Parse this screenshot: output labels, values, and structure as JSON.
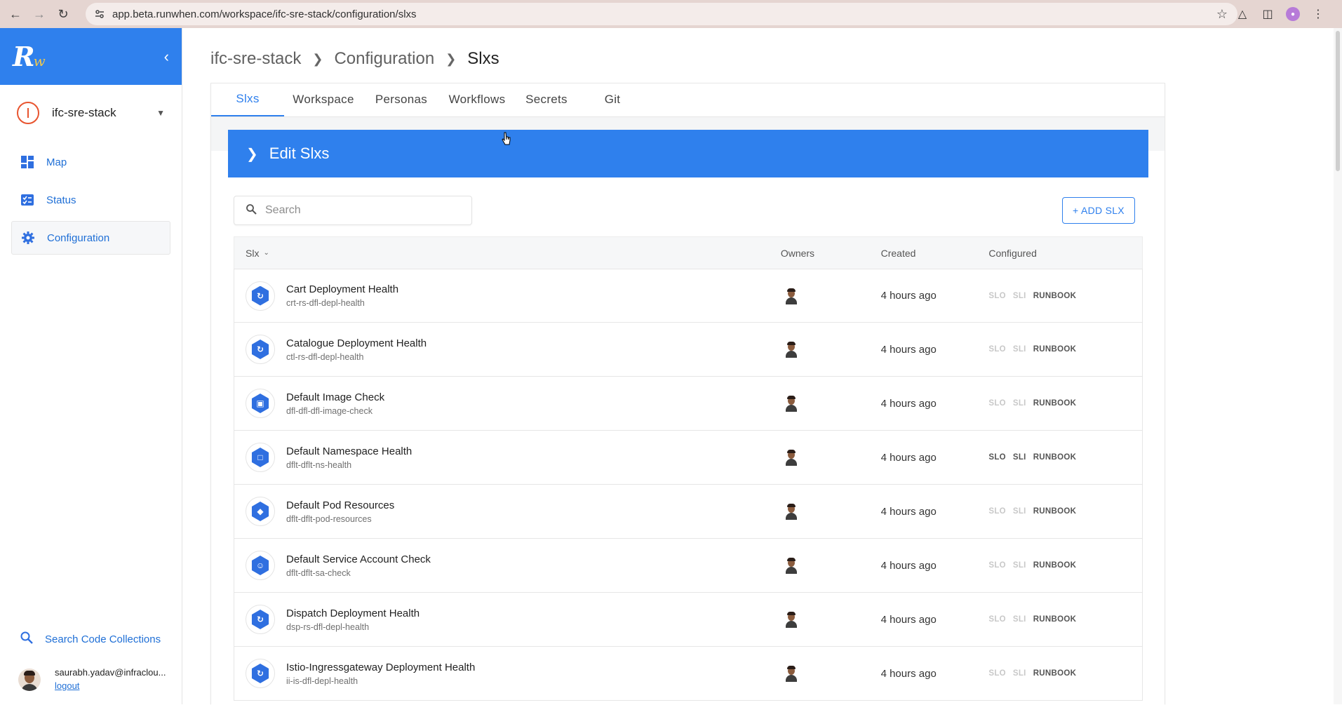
{
  "browser": {
    "url": "app.beta.runwhen.com/workspace/ifc-sre-stack/configuration/slxs"
  },
  "sidebar": {
    "logo_main": "R",
    "logo_small": "w",
    "workspace": "ifc-sre-stack",
    "items": [
      {
        "label": "Map",
        "icon": "dashboard-icon"
      },
      {
        "label": "Status",
        "icon": "checklist-icon"
      },
      {
        "label": "Configuration",
        "icon": "gear-icon"
      }
    ],
    "search_code_collections": "Search Code Collections",
    "user_email": "saurabh.yadav@infraclou...",
    "logout": "logout"
  },
  "breadcrumb": [
    "ifc-sre-stack",
    "Configuration",
    "Slxs"
  ],
  "tabs": [
    "Slxs",
    "Workspace",
    "Personas",
    "Workflows",
    "Secrets",
    "Git"
  ],
  "banner": {
    "title": "Edit Slxs"
  },
  "search": {
    "placeholder": "Search"
  },
  "add_button": "+ ADD SLX",
  "table": {
    "headers": {
      "slx": "Slx",
      "owners": "Owners",
      "created": "Created",
      "configured": "Configured"
    },
    "rows": [
      {
        "title": "Cart Deployment Health",
        "sub": "crt-rs-dfl-depl-health",
        "created": "4 hours ago",
        "slo": "SLO",
        "sli": "SLI",
        "runbook": "RUNBOOK",
        "slo_on": false,
        "sli_on": false,
        "icon": "deploy"
      },
      {
        "title": "Catalogue Deployment Health",
        "sub": "ctl-rs-dfl-depl-health",
        "created": "4 hours ago",
        "slo": "SLO",
        "sli": "SLI",
        "runbook": "RUNBOOK",
        "slo_on": false,
        "sli_on": false,
        "icon": "deploy"
      },
      {
        "title": "Default Image Check",
        "sub": "dfl-dfl-dfl-image-check",
        "created": "4 hours ago",
        "slo": "SLO",
        "sli": "SLI",
        "runbook": "RUNBOOK",
        "slo_on": false,
        "sli_on": false,
        "icon": "image"
      },
      {
        "title": "Default Namespace Health",
        "sub": "dflt-dflt-ns-health",
        "created": "4 hours ago",
        "slo": "SLO",
        "sli": "SLI",
        "runbook": "RUNBOOK",
        "slo_on": true,
        "sli_on": true,
        "icon": "namespace"
      },
      {
        "title": "Default Pod Resources",
        "sub": "dflt-dflt-pod-resources",
        "created": "4 hours ago",
        "slo": "SLO",
        "sli": "SLI",
        "runbook": "RUNBOOK",
        "slo_on": false,
        "sli_on": false,
        "icon": "pod"
      },
      {
        "title": "Default Service Account Check",
        "sub": "dflt-dflt-sa-check",
        "created": "4 hours ago",
        "slo": "SLO",
        "sli": "SLI",
        "runbook": "RUNBOOK",
        "slo_on": false,
        "sli_on": false,
        "icon": "sa"
      },
      {
        "title": "Dispatch Deployment Health",
        "sub": "dsp-rs-dfl-depl-health",
        "created": "4 hours ago",
        "slo": "SLO",
        "sli": "SLI",
        "runbook": "RUNBOOK",
        "slo_on": false,
        "sli_on": false,
        "icon": "deploy"
      },
      {
        "title": "Istio-Ingressgateway Deployment Health",
        "sub": "ii-is-dfl-depl-health",
        "created": "4 hours ago",
        "slo": "SLO",
        "sli": "SLI",
        "runbook": "RUNBOOK",
        "slo_on": false,
        "sli_on": false,
        "icon": "deploy"
      }
    ]
  }
}
